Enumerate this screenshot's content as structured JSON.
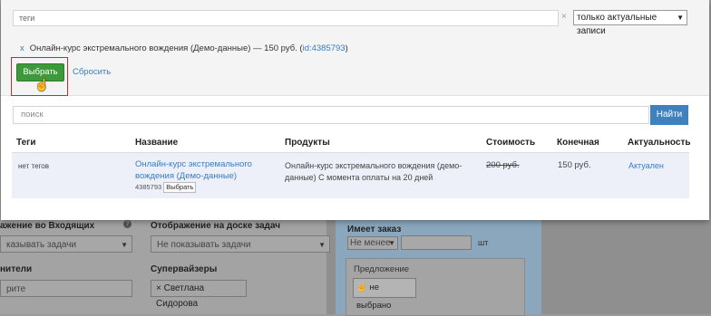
{
  "modal": {
    "tags_placeholder": "теги",
    "clear_symbol": "×",
    "filter_value": "только актуальные записи",
    "selected": {
      "remove": "x",
      "text": "Онлайн-курс экстремального вождения (Демо-данные) — 150 руб. (",
      "id_link": "id:4385793",
      "close_paren": ")"
    },
    "choose_label": "Выбрать",
    "reset_label": "Сбросить",
    "search_placeholder": "поиск",
    "search_button": "Найти",
    "columns": [
      "Теги",
      "Название",
      "Продукты",
      "Стоимость",
      "Конечная",
      "Актуальность"
    ],
    "row": {
      "tags": "нет тегов",
      "name": "Онлайн-курс экстремального вождения (Демо-данные)",
      "id": "4385793",
      "choose_small": "Выбрать",
      "products": "Онлайн-курс экстремального вождения (демо-данные) С момента оплаты на 20 дней",
      "price_old": "200 руб.",
      "price_final": "150 руб.",
      "status": "Актуален"
    }
  },
  "background": {
    "inbox_label": "ажение во Входящих",
    "inbox_select": "казывать задачи",
    "board_label": "Отображение на доске задач",
    "board_select": "Не показывать задачи",
    "executors_label": "нители",
    "executors_input": "рите",
    "supervisors_label": "Супервайзеры",
    "supervisor_tag": "Светлана Сидорова",
    "supervisor_remove": "×",
    "has_order_label": "Имеет заказ",
    "has_order_select": "Не менее",
    "has_order_unit": "шт",
    "offer_label": "Предложение",
    "offer_button": "не выбрано"
  }
}
